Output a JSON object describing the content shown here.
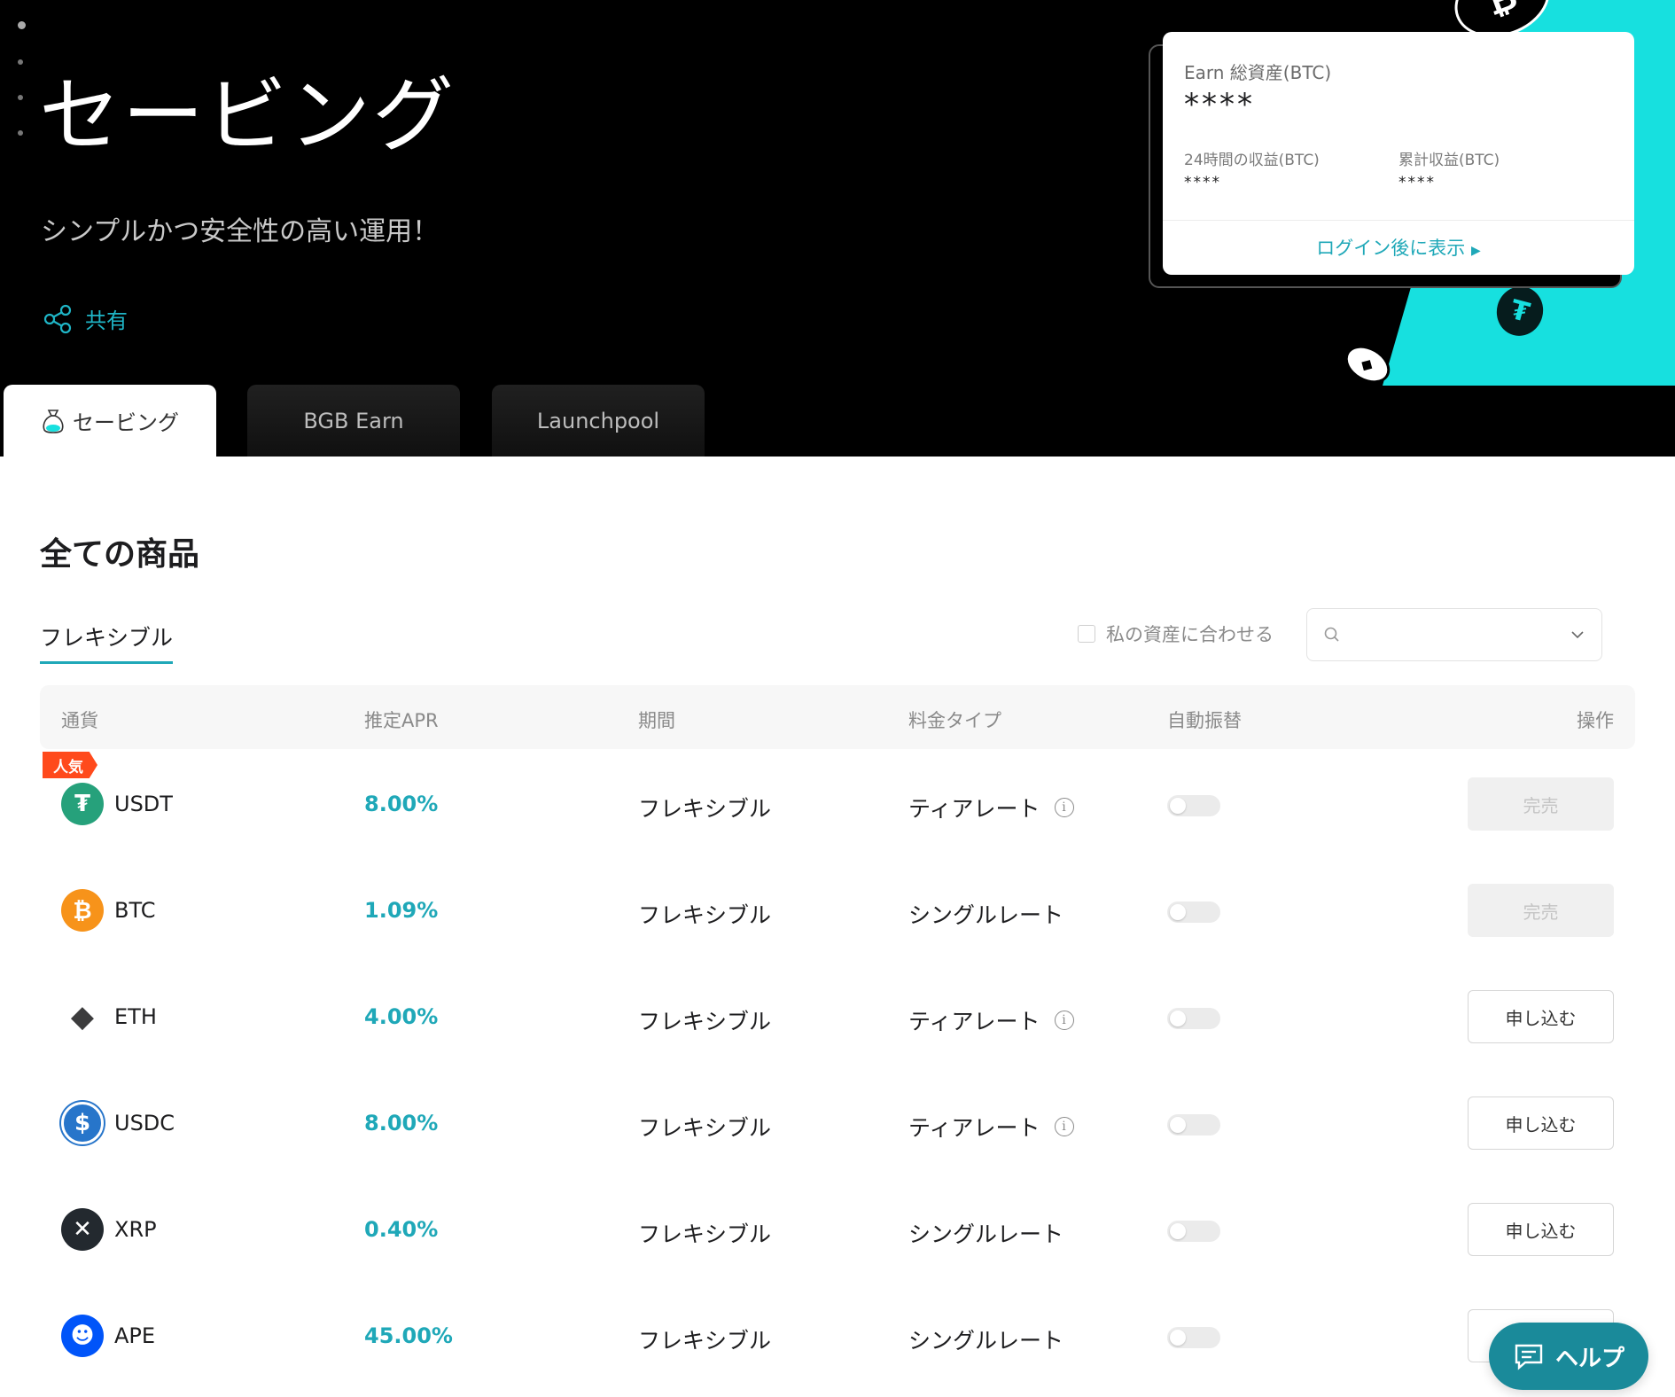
{
  "hero": {
    "title": "セービング",
    "subtitle": "シンプルかつ安全性の高い運用！",
    "share_label": "共有"
  },
  "asset_card": {
    "total_label": "Earn 総資産(BTC)",
    "total_value": "****",
    "income_24h_label": "24時間の収益(BTC)",
    "income_24h_value": "****",
    "cumulative_label": "累計収益(BTC)",
    "cumulative_value": "****",
    "login_link": "ログイン後に表示"
  },
  "tabs": [
    {
      "label": "セービング",
      "active": true
    },
    {
      "label": "BGB Earn",
      "active": false
    },
    {
      "label": "Launchpool",
      "active": false
    }
  ],
  "main": {
    "section_title": "全ての商品",
    "subtab": "フレキシブル",
    "match_assets_label": "私の資産に合わせる",
    "search_placeholder": ""
  },
  "table": {
    "headers": {
      "currency": "通貨",
      "apr": "推定APR",
      "period": "期間",
      "rate_type": "料金タイプ",
      "auto_transfer": "自動振替",
      "action": "操作"
    },
    "popular_badge": "人気",
    "rows": [
      {
        "symbol": "USDT",
        "apr": "8.00%",
        "period": "フレキシブル",
        "rate_type": "ティアレート",
        "has_info": true,
        "action": "完売",
        "sold_out": true,
        "icon": "tether-icon",
        "color": "#26a17b",
        "glyph": "₮"
      },
      {
        "symbol": "BTC",
        "apr": "1.09%",
        "period": "フレキシブル",
        "rate_type": "シングルレート",
        "has_info": false,
        "action": "完売",
        "sold_out": true,
        "icon": "bitcoin-icon",
        "color": "#f7931a",
        "glyph": "₿"
      },
      {
        "symbol": "ETH",
        "apr": "4.00%",
        "period": "フレキシブル",
        "rate_type": "ティアレート",
        "has_info": true,
        "action": "申し込む",
        "sold_out": false,
        "icon": "ethereum-icon",
        "color": "#ffffff",
        "glyph": "◆"
      },
      {
        "symbol": "USDC",
        "apr": "8.00%",
        "period": "フレキシブル",
        "rate_type": "ティアレート",
        "has_info": true,
        "action": "申し込む",
        "sold_out": false,
        "icon": "usdc-icon",
        "color": "#2775ca",
        "glyph": "$"
      },
      {
        "symbol": "XRP",
        "apr": "0.40%",
        "period": "フレキシブル",
        "rate_type": "シングルレート",
        "has_info": false,
        "action": "申し込む",
        "sold_out": false,
        "icon": "xrp-icon",
        "color": "#23292f",
        "glyph": "✕"
      },
      {
        "symbol": "APE",
        "apr": "45.00%",
        "period": "フレキシブル",
        "rate_type": "シングルレート",
        "has_info": false,
        "action": "申し込む",
        "sold_out": false,
        "icon": "apecoin-icon",
        "color": "#0054f9",
        "glyph": "☻"
      }
    ]
  },
  "help_button": "ヘルプ",
  "colors": {
    "accent": "#1fa8b8",
    "hero_cyan": "#17e0df",
    "popular": "#ff4a1c"
  }
}
